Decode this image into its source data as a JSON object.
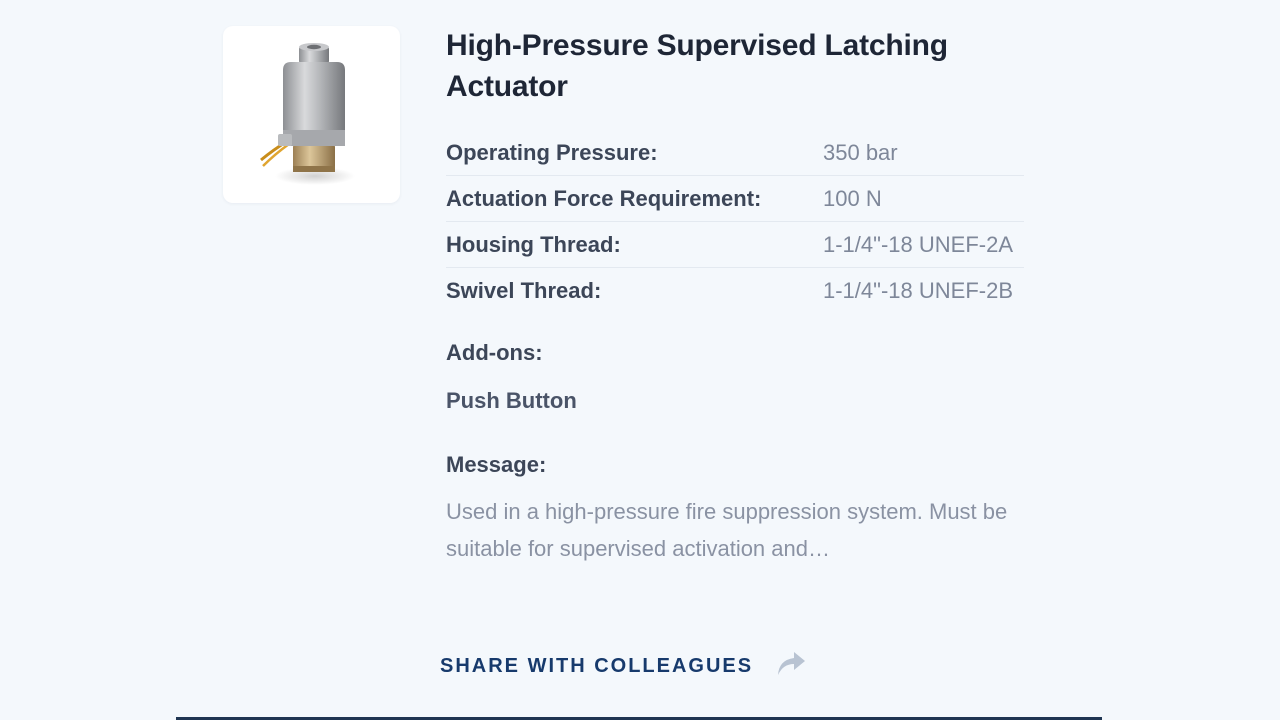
{
  "product": {
    "title": "High-Pressure Supervised Latching Actuator",
    "image_icon": "actuator-product-photo"
  },
  "specs": [
    {
      "label": "Operating Pressure:",
      "value": "350 bar"
    },
    {
      "label": "Actuation Force Requirement:",
      "value": "100 N"
    },
    {
      "label": "Housing Thread:",
      "value": "1-1/4\"-18 UNEF-2A"
    },
    {
      "label": "Swivel Thread:",
      "value": "1-1/4\"-18 UNEF-2B"
    }
  ],
  "addons": {
    "heading": "Add-ons:",
    "items": [
      "Push Button"
    ]
  },
  "message": {
    "heading": "Message:",
    "text": "Used in a high-pressure fire suppression system. Must be suitable for supervised activation and…"
  },
  "share": {
    "label": "SHARE WITH COLLEAGUES",
    "icon": "share-arrow-icon"
  },
  "colors": {
    "background": "#f4f8fc",
    "accent": "#173a6c",
    "title": "#1e2636",
    "muted": "#8a92a3"
  }
}
